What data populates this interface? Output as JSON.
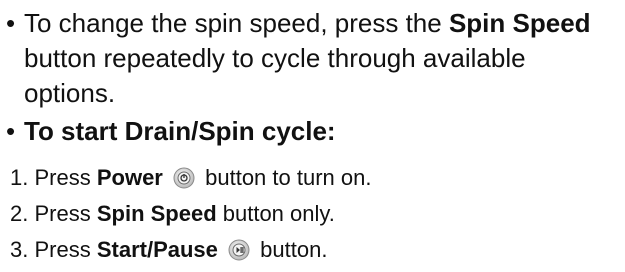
{
  "bullet": {
    "marker": "•",
    "line1_prefix": "To change the spin speed, press the ",
    "line1_bold": "Spin Speed",
    "line2": "button repeatedly to cycle through available",
    "line3": "options."
  },
  "section": {
    "marker": "•",
    "heading": "To start Drain/Spin cycle:"
  },
  "steps": [
    {
      "number": "1.",
      "prefix": "Press ",
      "bold": "Power",
      "icon": "power-button-icon",
      "suffix": "button to turn on."
    },
    {
      "number": "2.",
      "prefix": "Press ",
      "bold": "Spin Speed",
      "suffix": " button only."
    },
    {
      "number": "3.",
      "prefix": "Press ",
      "bold": "Start/Pause",
      "icon": "start-pause-button-icon",
      "suffix": "button."
    }
  ]
}
